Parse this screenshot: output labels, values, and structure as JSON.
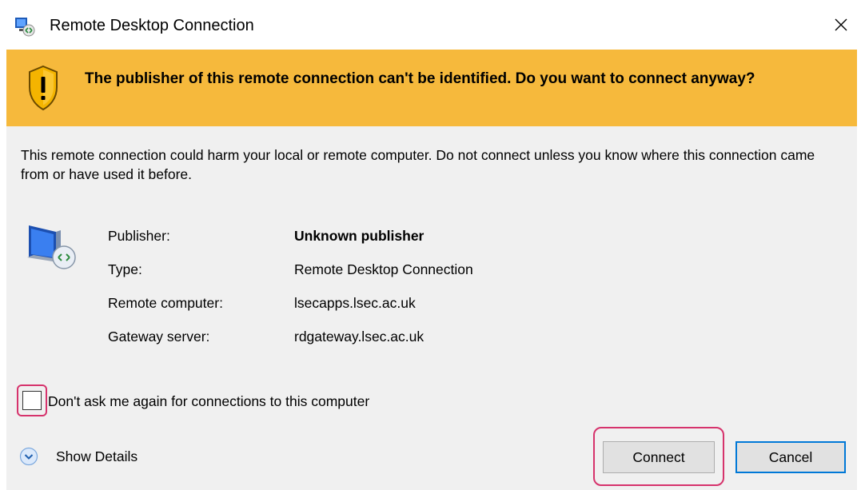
{
  "window": {
    "title": "Remote Desktop Connection",
    "title_icon": "remote-desktop-icon",
    "close_icon": "close-icon"
  },
  "banner": {
    "icon": "warning-shield-icon",
    "text": "The publisher of this remote connection can't be identified. Do you want to connect anyway?",
    "background": "#f6b93c"
  },
  "body": {
    "warning": "This remote connection could harm your local or remote computer. Do not connect unless you know where this connection came from or have used it before.",
    "icon": "remote-monitor-icon"
  },
  "details": [
    {
      "label": "Publisher:",
      "value": "Unknown publisher"
    },
    {
      "label": "Type:",
      "value": "Remote Desktop Connection"
    },
    {
      "label": "Remote computer:",
      "value": "lsecapps.lsec.ac.uk"
    },
    {
      "label": "Gateway server:",
      "value": "rdgateway.lsec.ac.uk"
    }
  ],
  "dont_ask_checkbox": {
    "label": "Don't ask me again for connections to this computer",
    "checked": false
  },
  "show_details": {
    "label": "Show Details",
    "icon": "chevron-down-circle-icon"
  },
  "buttons": {
    "connect": "Connect",
    "cancel": "Cancel"
  },
  "colors": {
    "highlight": "#d6336c",
    "focus_border": "#0078d7",
    "content_bg": "#f0f0f0"
  }
}
